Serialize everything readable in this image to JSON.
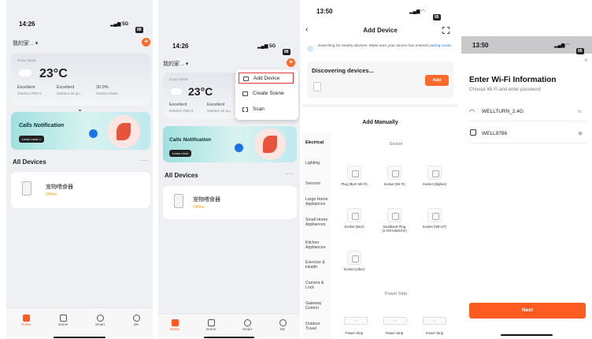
{
  "screen1": {
    "status": {
      "time": "14:26",
      "signal": "5G",
      "battery": "88"
    },
    "home_title": "我的家 ..",
    "weather": {
      "location": "Cozy Home",
      "temperature": "23°C",
      "stats": [
        {
          "value": "Excellent",
          "label": "Outdoor PM2.5"
        },
        {
          "value": "Excellent",
          "label": "Outdoor air qu..."
        },
        {
          "value": "30.0%",
          "label": "Outdoor humi..."
        }
      ]
    },
    "banner": {
      "title": "Calls Notification",
      "cta": "Learn more >"
    },
    "section": "All Devices",
    "device": {
      "name": "宠物喂食器",
      "status": "Offline"
    },
    "tabs": [
      {
        "label": "Home",
        "icon": "home-icon",
        "active": true
      },
      {
        "label": "Scene",
        "icon": "scene-icon",
        "active": false
      },
      {
        "label": "Smart",
        "icon": "smart-icon",
        "active": false
      },
      {
        "label": "Me",
        "icon": "me-icon",
        "active": false
      }
    ]
  },
  "screen2": {
    "status": {
      "time": "14:26",
      "signal": "5G",
      "battery": "88"
    },
    "home_title": "我的家 ..",
    "weather": {
      "location": "Cozy Home",
      "temperature": "23°C",
      "stats": [
        {
          "value": "Excellent",
          "label": "Outdoor PM2.5"
        },
        {
          "value": "Excellent",
          "label": "Outdoor air qu..."
        }
      ]
    },
    "menu": [
      {
        "label": "Add Device",
        "icon": "add-device-icon",
        "selected": true
      },
      {
        "label": "Create Scene",
        "icon": "create-scene-icon",
        "selected": false
      },
      {
        "label": "Scan",
        "icon": "scan-icon",
        "selected": false
      }
    ],
    "banner": {
      "title": "Calls Notification",
      "cta": "Learn more"
    },
    "section": "All Devices",
    "device": {
      "name": "宠物喂食器",
      "status": "Offline"
    },
    "tabs": [
      {
        "label": "Home",
        "icon": "home-icon",
        "active": true
      },
      {
        "label": "Scene",
        "icon": "scene-icon",
        "active": false
      },
      {
        "label": "Smart",
        "icon": "smart-icon",
        "active": false
      },
      {
        "label": "Me",
        "icon": "me-icon",
        "active": false
      }
    ]
  },
  "screen3": {
    "status": {
      "time": "13:50",
      "battery": "95"
    },
    "title": "Add Device",
    "search_text": "Searching for nearby devices. Make sure your device has entered",
    "search_link": "pairing mode.",
    "discovering": "Discovering devices...",
    "add_label": "Add",
    "add_manually": "Add Manually",
    "categories": [
      "Electrical",
      "Lighting",
      "Sensors",
      "Large Home Appliances",
      "Small Home Appliances",
      "Kitchen Appliances",
      "Exercise & Health",
      "Camera & Lock",
      "Gateway Control",
      "Outdoor Travel"
    ],
    "socket_header": "Socket",
    "sockets": [
      "Plug (BLE+Wi-Fi)",
      "Socket (Wi-Fi)",
      "Socket (Zigbee)",
      "Socket (BLE)",
      "Dualband Plug (2.4GHz&5GHz)",
      "Socket (NB-IoT)",
      "Socket (other)"
    ],
    "power_strip_header": "Power Strip",
    "power_strips": [
      "Power Strip",
      "Power Strip",
      "Power Strip"
    ]
  },
  "screen4": {
    "status": {
      "time": "13:50",
      "battery": "95"
    },
    "title": "Enter Wi-Fi Information",
    "subtitle": "Choose Wi-Fi and enter password",
    "ssid": "WELLTURN_2.4G",
    "password": "WELL9786",
    "next_label": "Next"
  }
}
